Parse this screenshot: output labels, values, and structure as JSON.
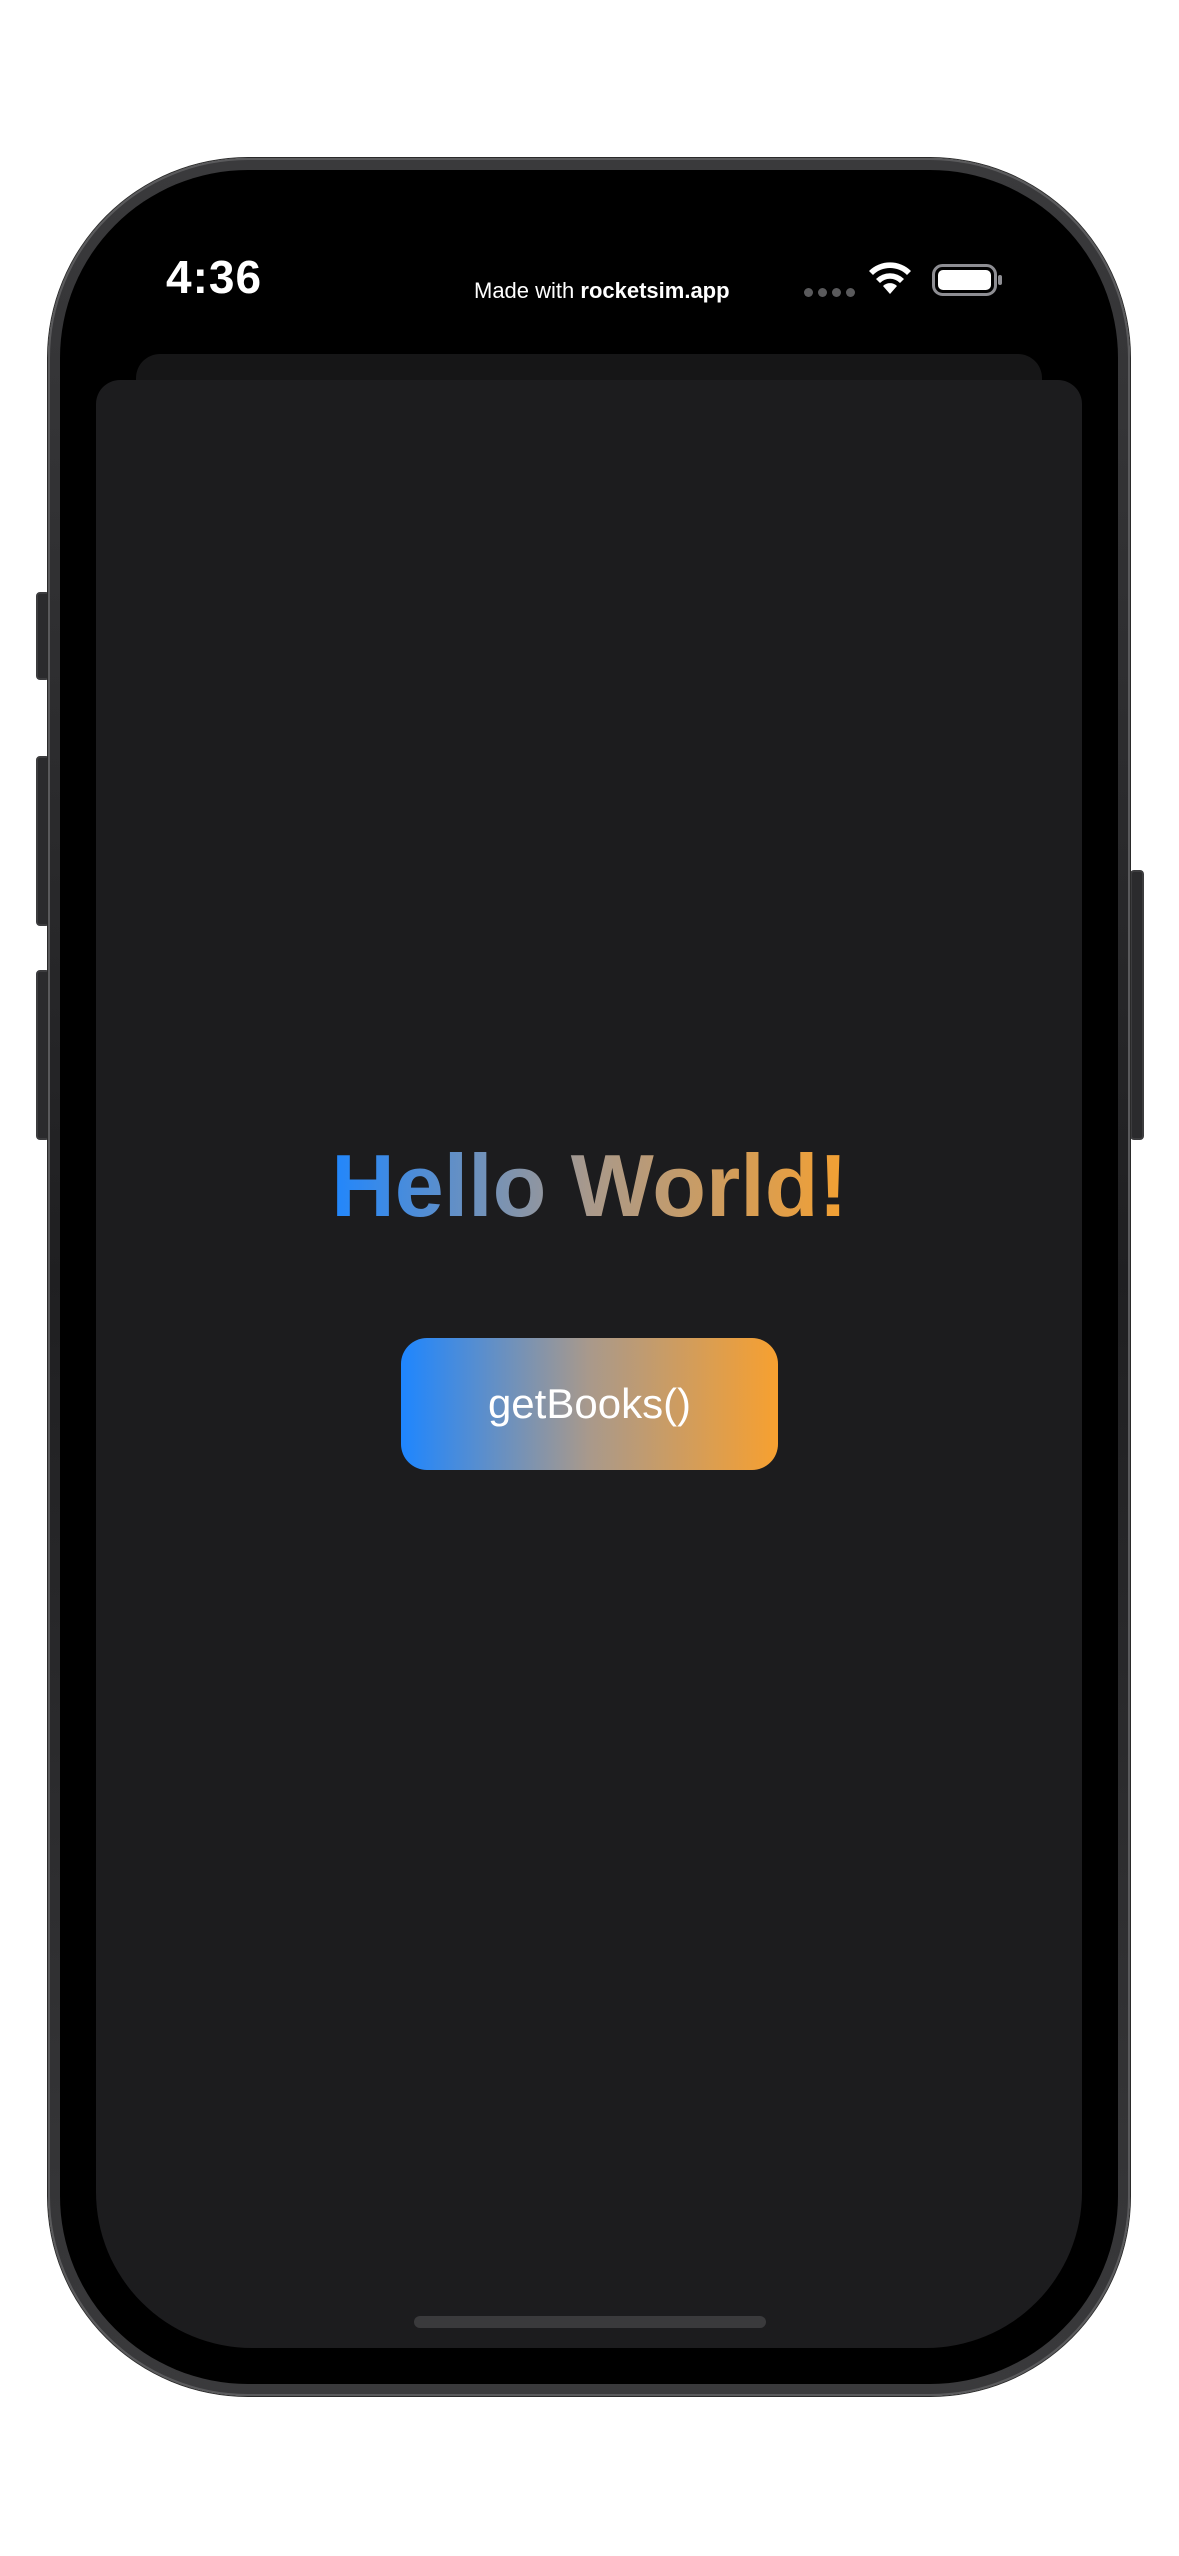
{
  "status_bar": {
    "time": "4:36",
    "made_with_prefix": "Made with ",
    "made_with_brand": "rocketsim.app",
    "icons": [
      "signal-dots-icon",
      "wifi-icon",
      "battery-icon"
    ]
  },
  "main": {
    "title": "Hello World!",
    "button_label": "getBooks()"
  },
  "colors": {
    "gradient_start": "#1e86ff",
    "gradient_mid": "#a9998b",
    "gradient_end": "#f5a030",
    "sheet_background": "#1c1c1e",
    "screen_background": "#000000"
  }
}
